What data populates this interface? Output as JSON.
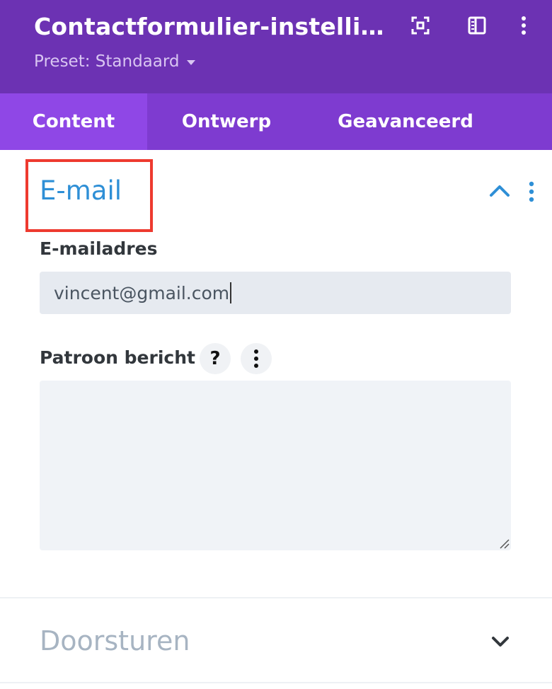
{
  "header": {
    "title": "Contactformulier-instelling…",
    "preset_label": "Preset: Standaard",
    "icons": [
      "focus-icon",
      "sidebar-icon",
      "more-vertical-icon"
    ]
  },
  "tabs": [
    {
      "label": "Content",
      "active": true
    },
    {
      "label": "Ontwerp",
      "active": false
    },
    {
      "label": "Geavanceerd",
      "active": false
    }
  ],
  "section_email": {
    "title": "E-mail",
    "expanded": true,
    "email_label": "E-mailadres",
    "email_value": "vincent@gmail.com",
    "pattern_label": "Patroon bericht",
    "help_glyph": "?",
    "pattern_value": ""
  },
  "section_forward": {
    "title": "Doorsturen",
    "expanded": false
  },
  "colors": {
    "header_bg": "#6c32b3",
    "tabs_bg": "#7e3bd0",
    "active_tab_bg": "#8f47e6",
    "section_title": "#2e8fd6",
    "highlight": "#ee3a2f"
  }
}
